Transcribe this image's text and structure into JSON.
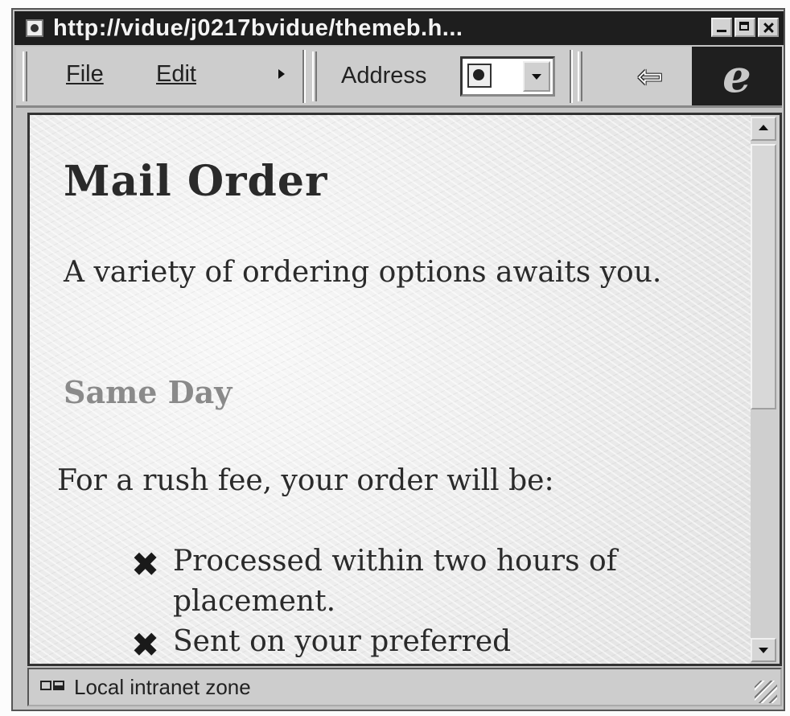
{
  "window": {
    "title": "http://vidue/j0217bvidue/themeb.h...",
    "page_icon": "ie-page-icon"
  },
  "toolbar": {
    "menu": [
      "File",
      "Edit"
    ],
    "address_label": "Address",
    "back_icon": "back-arrow-icon",
    "brand_icon": "ie-logo-icon",
    "brand_glyph": "e"
  },
  "content": {
    "heading": "Mail Order",
    "intro": "A variety of ordering options awaits you.",
    "subheading": "Same Day",
    "lead": "For a rush fee, your order will be:",
    "bullets": [
      "Processed within two hours of placement.",
      "Sent on your preferred"
    ]
  },
  "status": {
    "zone": "Local intranet zone"
  }
}
